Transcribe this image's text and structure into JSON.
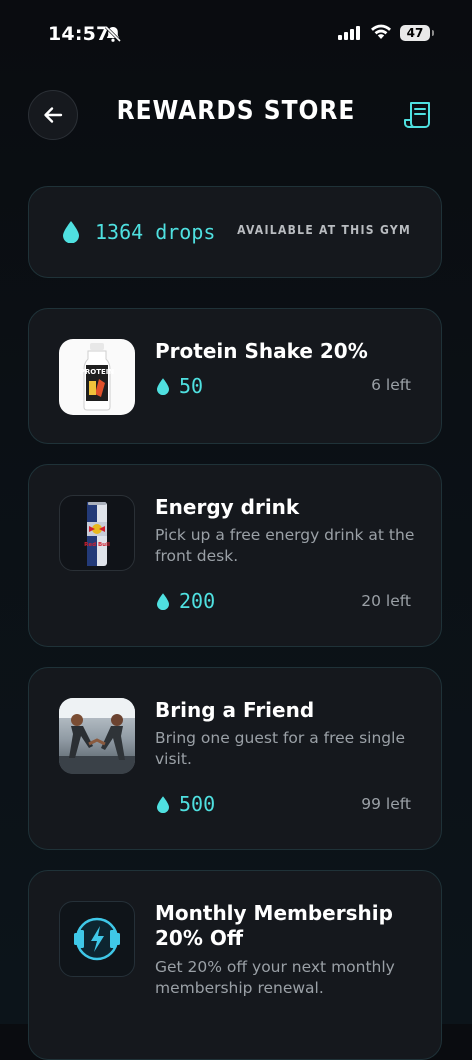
{
  "status": {
    "time": "14:57",
    "battery": "47"
  },
  "header": {
    "title": "REWARDS STORE"
  },
  "balance": {
    "text": "1364 drops",
    "availability": "AVAILABLE AT THIS GYM"
  },
  "rewards": [
    {
      "title": "Protein Shake 20%",
      "description": "",
      "cost": "50",
      "left": "6 left",
      "image": "protein-shake"
    },
    {
      "title": "Energy drink",
      "description": "Pick up a free energy drink at the front desk.",
      "cost": "200",
      "left": "20 left",
      "image": "energy-drink-can"
    },
    {
      "title": "Bring a Friend",
      "description": "Bring one guest for a free single visit.",
      "cost": "500",
      "left": "99 left",
      "image": "two-people-workout"
    },
    {
      "title": "Monthly Membership 20% Off",
      "description": "Get 20% off your next monthly membership renewal.",
      "cost": "",
      "left": "",
      "image": "dumbbell-lightning-badge"
    }
  ],
  "colors": {
    "accent": "#4fe0e0",
    "card_bg": "#15181d",
    "card_border": "#1f3238",
    "muted_text": "#9aa0a6"
  }
}
